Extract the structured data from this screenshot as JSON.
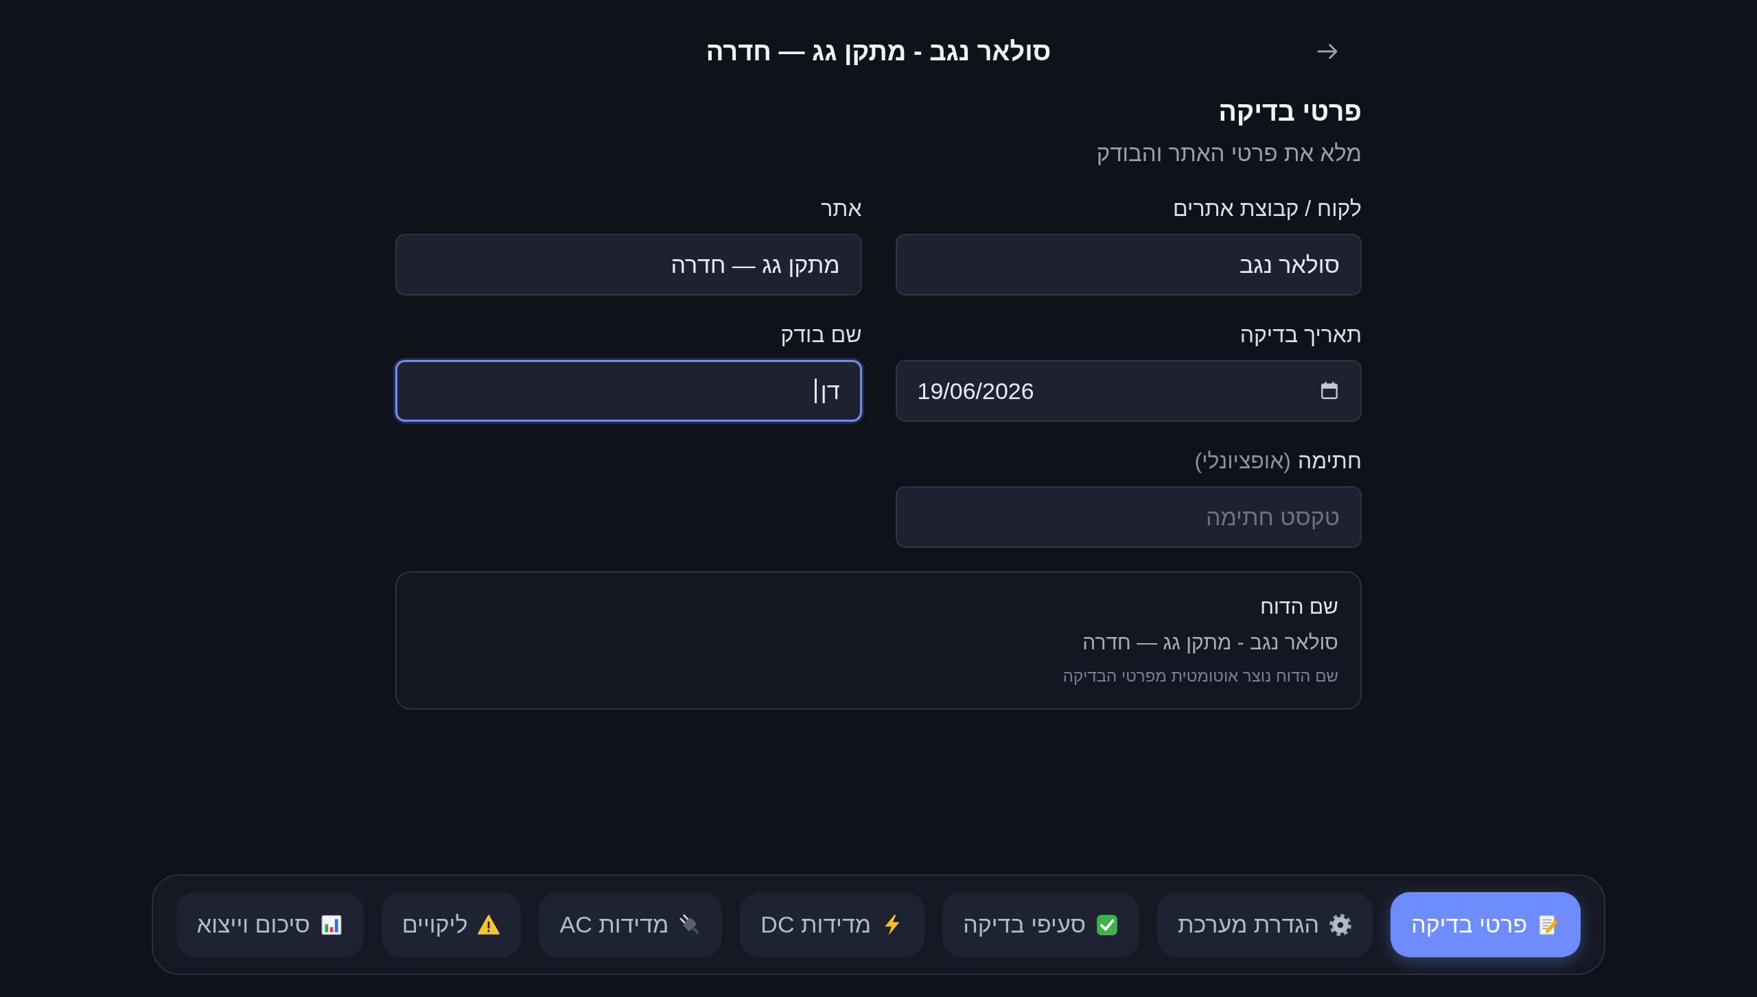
{
  "header": {
    "title": "סולאר נגב - מתקן גג — חדרה"
  },
  "section": {
    "title": "פרטי בדיקה",
    "subtitle": "מלא את פרטי האתר והבודק"
  },
  "fields": [
    {
      "kind": "text",
      "label": "לקוח / קבוצת אתרים",
      "value": "סולאר נגב",
      "focused": false
    },
    {
      "kind": "text",
      "label": "אתר",
      "value": "מתקן גג — חדרה",
      "focused": false
    },
    {
      "kind": "date",
      "label": "תאריך בדיקה",
      "value": "19/06/2026",
      "focused": false
    },
    {
      "kind": "text",
      "label": "שם בודק",
      "value": "דן",
      "focused": true
    },
    {
      "kind": "text",
      "label": "חתימה",
      "note": "(אופציונלי)",
      "placeholder": "טקסט חתימה",
      "focused": false
    }
  ],
  "report_name": {
    "title": "שם הדוח",
    "value": "סולאר נגב - מתקן גג — חדרה",
    "hint": "שם הדוח נוצר אוטומטית מפרטי הבדיקה"
  },
  "nav": [
    {
      "label": "פרטי בדיקה",
      "selected": true
    },
    {
      "label": "הגדרת מערכת",
      "selected": false
    },
    {
      "label": "סעיפי בדיקה",
      "selected": false
    },
    {
      "label": "מדידות DC",
      "selected": false
    },
    {
      "label": "מדידות AC",
      "selected": false
    },
    {
      "label": "ליקויים",
      "selected": false
    },
    {
      "label": "סיכום וייצוא",
      "selected": false
    }
  ]
}
